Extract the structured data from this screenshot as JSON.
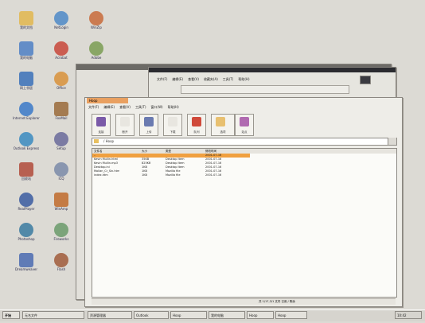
{
  "desktop": {
    "icons": [
      {
        "label": "我的文档",
        "icon": "folder-icon"
      },
      {
        "label": "NetLogin",
        "icon": "globe-icon"
      },
      {
        "label": "WinZip",
        "icon": "archive-icon"
      },
      {
        "label": "我的电脑",
        "icon": "computer-icon"
      },
      {
        "label": "Acrobat",
        "icon": "acrobat-icon"
      },
      {
        "label": "Adobe",
        "icon": "app-icon"
      },
      {
        "label": "网上邻居",
        "icon": "network-icon"
      },
      {
        "label": "Office",
        "icon": "office-icon"
      },
      {
        "label": "Internet Explorer",
        "icon": "ie-icon"
      },
      {
        "label": "FoxMail",
        "icon": "mail-icon"
      },
      {
        "label": "Outlook Express",
        "icon": "outlook-icon"
      },
      {
        "label": "Setup",
        "icon": "setup-icon"
      },
      {
        "label": "回收站",
        "icon": "recycle-bin-icon"
      },
      {
        "label": "ICQ",
        "icon": "icq-icon"
      },
      {
        "label": "RealPlayer",
        "icon": "realplayer-icon"
      },
      {
        "label": "WinAmp",
        "icon": "winamp-icon"
      },
      {
        "label": "Photoshop",
        "icon": "photoshop-icon"
      },
      {
        "label": "Fireworks",
        "icon": "fireworks-icon"
      },
      {
        "label": "Dreamweaver",
        "icon": "dreamweaver-icon"
      },
      {
        "label": "Flash",
        "icon": "flash-icon"
      }
    ]
  },
  "back_window": {
    "menu": [
      "文件(F)",
      "编辑(E)",
      "查看(V)",
      "收藏夹(A)",
      "工具(T)",
      "帮助(H)"
    ],
    "tabs": [
      "资源管理器",
      "搜索",
      "收藏"
    ]
  },
  "main_window": {
    "tab": "Hoop",
    "menu": [
      "文件(F)",
      "编辑(E)",
      "查看(V)",
      "工具(T)",
      "窗口(W)",
      "帮助(H)"
    ],
    "toolbar": [
      {
        "label": "连接",
        "icon": "connect-icon"
      },
      {
        "label": "断开",
        "icon": "disconnect-icon"
      },
      {
        "label": "上传",
        "icon": "upload-icon"
      },
      {
        "label": "下载",
        "icon": "download-icon"
      },
      {
        "label": "队列",
        "icon": "queue-icon"
      },
      {
        "label": "选项",
        "icon": "options-icon"
      },
      {
        "label": "站点",
        "icon": "site-icon"
      }
    ],
    "address": "/ Hoop",
    "columns": [
      "文件名",
      "大小",
      "类型",
      "修改时间"
    ],
    "files": [
      {
        "name": "..",
        "size": "",
        "type": "",
        "date": "2001-07-16"
      },
      {
        "name": "Kevin Mullin.html",
        "size": "35KB",
        "type": "Desktop Item",
        "date": "2001-07-16"
      },
      {
        "name": "Kevin Mullin.mp3",
        "size": "825KB",
        "type": "Desktop Item",
        "date": "2001-07-16"
      },
      {
        "name": "Desktop.ini",
        "size": "1KB",
        "type": "Desktop Item",
        "date": "2001-07-16"
      },
      {
        "name": "Mollan_Cr_Sin.htm",
        "size": "1KB",
        "type": "Mozilla file",
        "date": "2001-07-16"
      },
      {
        "name": "index.htm",
        "size": "1KB",
        "type": "Mozilla file",
        "date": "2001-07-16"
      }
    ],
    "status": "共 1/17,3/1 文件  已用 / 剩余"
  },
  "taskbar": {
    "start": "开始",
    "items": [
      "无名文件",
      "资源管理器",
      "Outlook",
      "Hoop",
      "我的电脑",
      "Hoop",
      "Hoop"
    ],
    "clock": "10:42"
  },
  "colors": {
    "desktop": "#dcdad4",
    "title_bar": "#6c6a66",
    "active_tab": "#e9a060",
    "selection": "#f0a040"
  }
}
